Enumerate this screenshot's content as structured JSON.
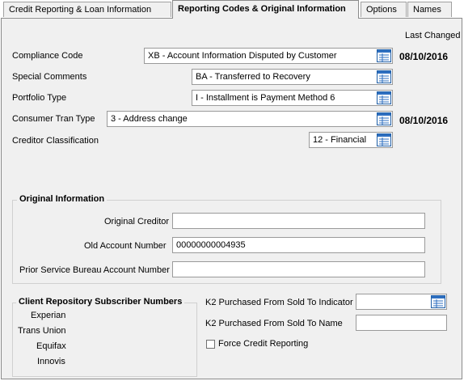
{
  "tabs": [
    {
      "label": "Credit Reporting & Loan Information"
    },
    {
      "label": "Reporting Codes & Original Information"
    },
    {
      "label": "Options"
    },
    {
      "label": "Names"
    }
  ],
  "header": {
    "last_changed_label": "Last Changed"
  },
  "reporting_codes": {
    "compliance_code": {
      "label": "Compliance Code",
      "value": "XB - Account Information Disputed by Customer",
      "last_changed": "08/10/2016"
    },
    "special_comments": {
      "label": "Special Comments",
      "value": "BA - Transferred to Recovery"
    },
    "portfolio_type": {
      "label": "Portfolio Type",
      "value": "I - Installment is Payment Method 6"
    },
    "consumer_tran_type": {
      "label": "Consumer Tran Type",
      "value": "3 - Address change",
      "last_changed": "08/10/2016"
    },
    "creditor_classification": {
      "label": "Creditor Classification",
      "value": "12 - Financial"
    }
  },
  "original_information": {
    "title": "Original Information",
    "original_creditor": {
      "label": "Original Creditor",
      "value": ""
    },
    "old_account_number": {
      "label": "Old Account Number",
      "value": "00000000004935"
    },
    "prior_service_bureau": {
      "label": "Prior Service Bureau Account Number",
      "value": ""
    }
  },
  "client_repository": {
    "title": "Client Repository Subscriber Numbers",
    "experian": "Experian",
    "trans_union": "Trans Union",
    "equifax": "Equifax",
    "innovis": "Innovis"
  },
  "k2": {
    "sold_to_indicator": {
      "label": "K2 Purchased From Sold To Indicator",
      "value": ""
    },
    "sold_to_name": {
      "label": "K2 Purchased From Sold To Name",
      "value": ""
    },
    "force_credit_reporting": {
      "label": "Force Credit Reporting",
      "checked": false
    }
  }
}
